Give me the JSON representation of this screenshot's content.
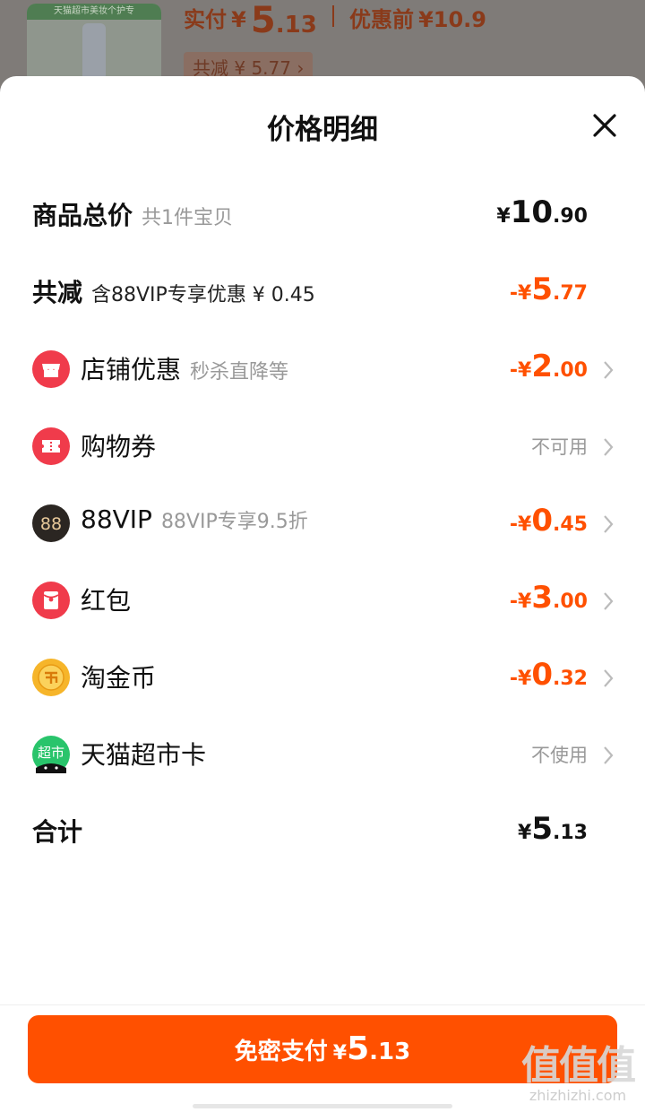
{
  "background": {
    "product_band": "天猫超市美妆个护专",
    "paid_label": "实付",
    "currency": "¥",
    "paid_int": "5",
    "paid_dec": ".13",
    "before_label": "优惠前",
    "before_value": "¥10.9",
    "saved_text": "共减 ¥ 5.77 ›"
  },
  "sheet": {
    "title": "价格明细",
    "close_icon": "close-icon",
    "rows": {
      "total": {
        "label": "商品总价",
        "sub": "共1件宝贝",
        "yen": "¥",
        "int": "10",
        "dec": ".90"
      },
      "discount": {
        "label": "共减",
        "sub": "含88VIP专享优惠 ¥ 0.45",
        "yen": "-¥",
        "int": "5",
        "dec": ".77"
      },
      "shop": {
        "label": "店铺优惠",
        "sub": "秒杀直降等",
        "yen": "-¥",
        "int": "2",
        "dec": ".00"
      },
      "coupon": {
        "label": "购物券",
        "value": "不可用"
      },
      "vip": {
        "label": "88VIP",
        "sub": "88VIP专享9.5折",
        "yen": "-¥",
        "int": "0",
        "dec": ".45",
        "badge": "88"
      },
      "redpacket": {
        "label": "红包",
        "yen": "-¥",
        "int": "3",
        "dec": ".00"
      },
      "coin": {
        "label": "淘金币",
        "yen": "-¥",
        "int": "0",
        "dec": ".32"
      },
      "card": {
        "label": "天猫超市卡",
        "value": "不使用",
        "badge": "超市"
      },
      "sum": {
        "label": "合计",
        "yen": "¥",
        "int": "5",
        "dec": ".13"
      }
    },
    "pay_button": {
      "label": "免密支付",
      "yen": "¥",
      "int": "5",
      "dec": ".13"
    },
    "watermark": {
      "logo": "值值值",
      "site": "zhizhizhi.com"
    }
  },
  "colors": {
    "accent": "#ff5000",
    "muted": "#999999",
    "shop_icon": "#f03b4b",
    "coin_icon": "#f6b52a",
    "card_icon": "#29c46b"
  }
}
